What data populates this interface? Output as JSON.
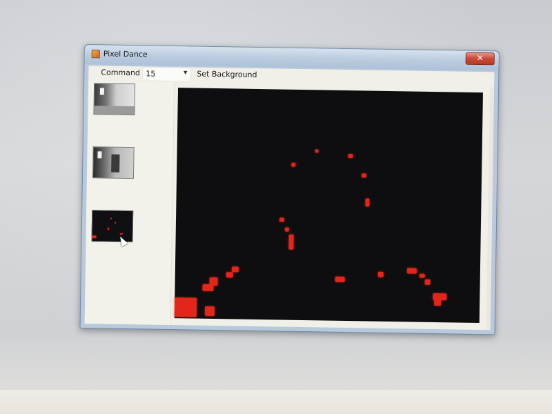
{
  "window": {
    "title": "Pixel Dance",
    "close_glyph": "✕"
  },
  "menu": {
    "command_label": "Command",
    "command_value": "15",
    "dropdown_icon": "chevron-down-icon",
    "set_background_label": "Set Background"
  },
  "thumbnails": [
    {
      "name": "camera-feed",
      "kind": "grayscale"
    },
    {
      "name": "background-frame",
      "kind": "grayscale"
    },
    {
      "name": "motion-mask",
      "kind": "red-on-black"
    }
  ],
  "colors": {
    "pixel": "#e3261a",
    "preview_background": "#0e0e10",
    "title_bar": "#bccde0",
    "close_button": "#c84a36"
  }
}
